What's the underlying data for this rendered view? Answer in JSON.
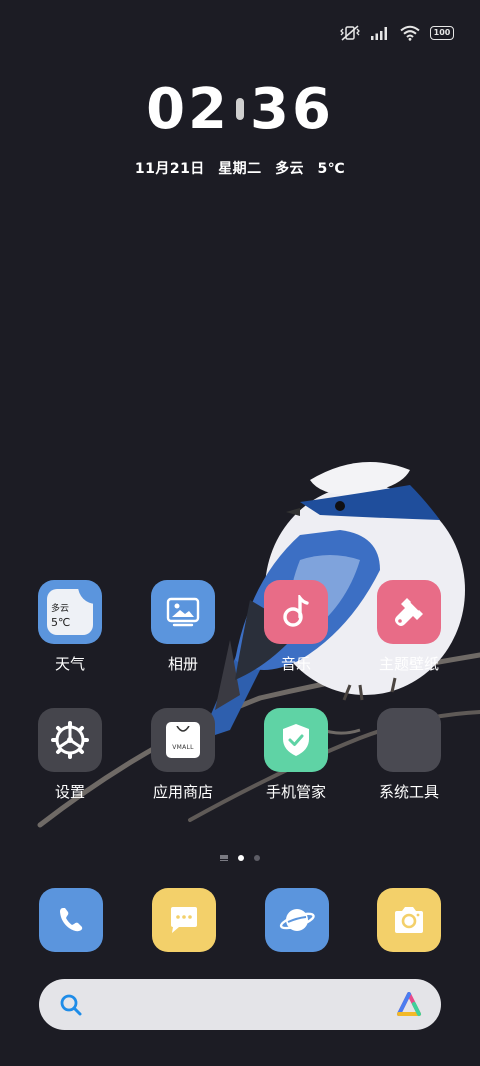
{
  "status_bar": {
    "icons": [
      "mute-vibrate-icon",
      "signal-icon",
      "wifi-icon"
    ],
    "battery": "100"
  },
  "clock": {
    "hours": "02",
    "minutes": "36"
  },
  "date": {
    "date": "11月21日",
    "weekday": "星期二",
    "weather": "多云",
    "temperature": "5℃"
  },
  "apps": [
    {
      "name": "weather",
      "label": "天气",
      "widget_weather": "多云",
      "widget_temp": "5℃"
    },
    {
      "name": "gallery",
      "label": "相册"
    },
    {
      "name": "music",
      "label": "音乐"
    },
    {
      "name": "themes",
      "label": "主题壁纸"
    },
    {
      "name": "settings",
      "label": "设置"
    },
    {
      "name": "appstore",
      "label": "应用商店",
      "store_text": "VMALL"
    },
    {
      "name": "phone-manager",
      "label": "手机管家"
    },
    {
      "name": "system-tools",
      "label": "系统工具"
    }
  ],
  "page_indicator": {
    "pages": 2,
    "current": 1
  },
  "dock": [
    "phone-icon",
    "messages-icon",
    "browser-icon",
    "camera-icon"
  ],
  "search": {
    "icon": "search-icon",
    "assistant_icon": "assistant-logo-icon"
  },
  "colors": {
    "background": "#1c1c24",
    "blue_icon": "#5b95dd",
    "pink_icon": "#e86c87",
    "green_icon": "#5fd3a5",
    "yellow_icon": "#f3d06a",
    "gray_icon": "#45454c"
  }
}
